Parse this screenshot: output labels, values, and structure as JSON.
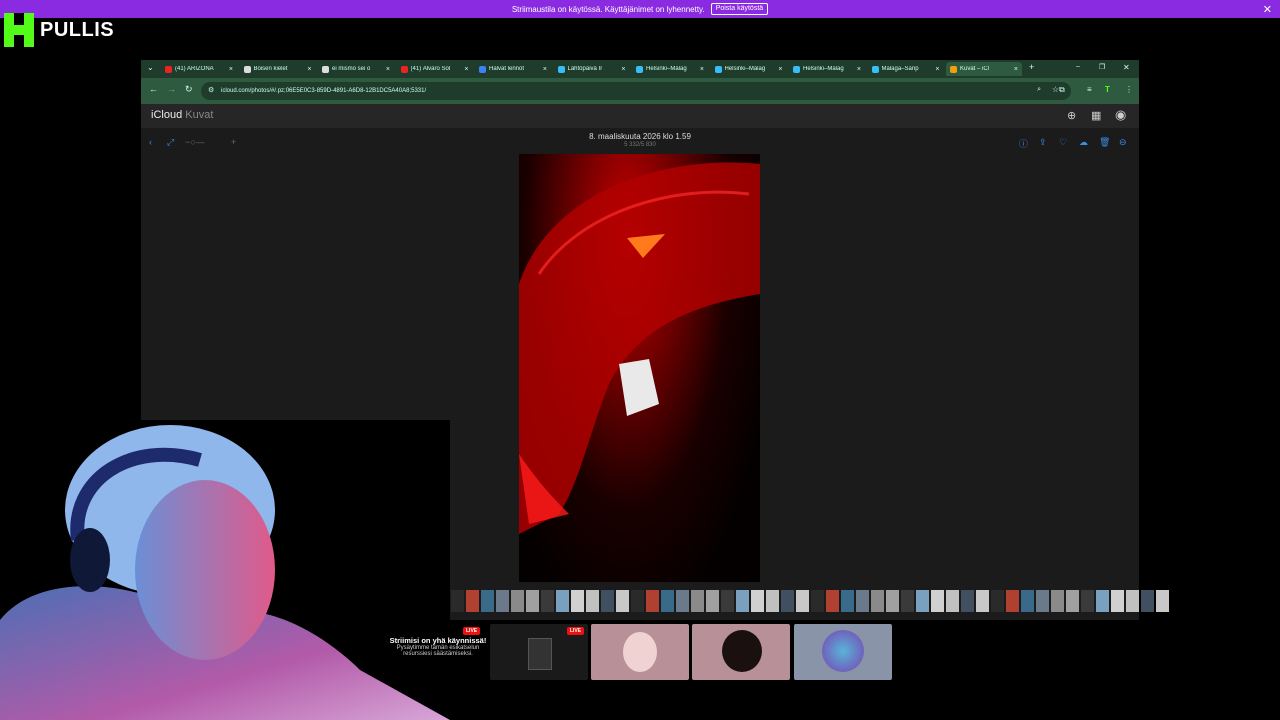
{
  "banner": {
    "message": "Striimaustila on käytössä. Käyttäjänimet on lyhennetty.",
    "button_label": "Poista käytöstä",
    "close_glyph": "✕"
  },
  "logo": {
    "text": "PULLIS",
    "brand_color": "#53fc18"
  },
  "browser": {
    "tabs": [
      {
        "label": "(41) ARIZONA",
        "color": "#e22"
      },
      {
        "label": "Boisen kielet",
        "color": "#ddd"
      },
      {
        "label": "ei mismo sei o",
        "color": "#ddd"
      },
      {
        "label": "(41) Álvaro Sol",
        "color": "#e22"
      },
      {
        "label": "Halvat lennot",
        "color": "#3b82f6"
      },
      {
        "label": "Lähtöpäivä Ir",
        "color": "#38bdf8"
      },
      {
        "label": "Helsinki–Málag",
        "color": "#38bdf8"
      },
      {
        "label": "Helsinki–Málag",
        "color": "#38bdf8"
      },
      {
        "label": "Helsinki–Málag",
        "color": "#38bdf8"
      },
      {
        "label": "Málaga–Sanp",
        "color": "#38bdf8"
      },
      {
        "label": "Kuvat – iCl",
        "color": "#f59e0b"
      }
    ],
    "new_tab_glyph": "+",
    "url": "icloud.com/photos/#/.pz;06E5E0C3-859D-4891-A6D8-12B1DC5A40A8;5331/",
    "window_controls": [
      "–",
      "❐",
      "✕"
    ]
  },
  "icloud": {
    "brand": "iCloud",
    "section": "Kuvat",
    "photo_date": "8. maaliskuuta 2026 klo 1.59",
    "photo_count": "5 332/5 830"
  },
  "live": {
    "title": "Striimisi on yhä käynnissä!",
    "subtitle": "Pysäytimme tämän esikatselun resurssiesi säästämiseksi.",
    "badge": "LIVE"
  }
}
